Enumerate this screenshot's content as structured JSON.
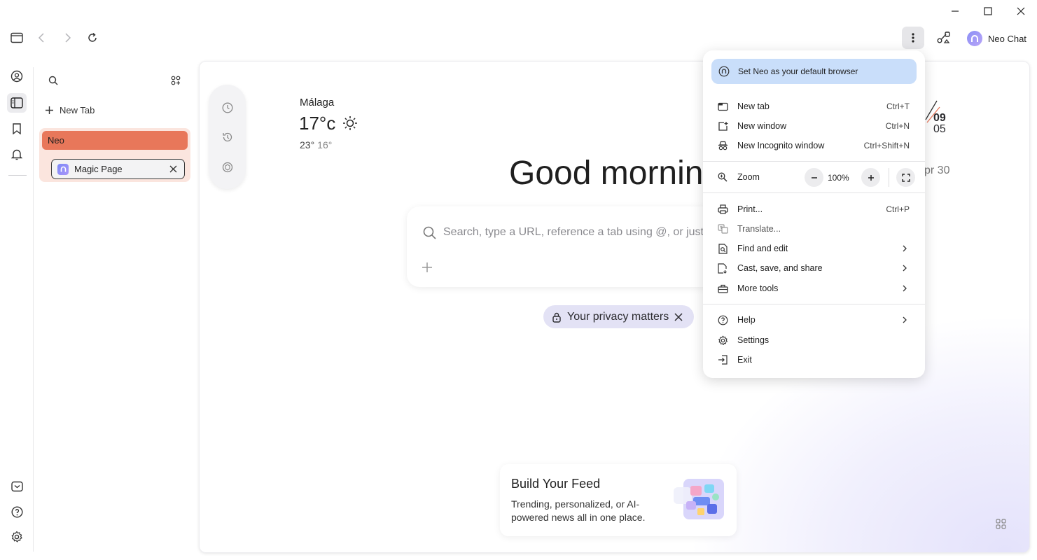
{
  "toolbar": {
    "profile_label": "Neo Chat"
  },
  "sidebar": {
    "new_tab": "New Tab",
    "group_name": "Neo",
    "tab_title": "Magic Page"
  },
  "weather": {
    "city": "Málaga",
    "temp": "17°c",
    "high": "23°",
    "low": "16°"
  },
  "clock": {
    "hour": "09",
    "minute": "05",
    "date_partial": "pr 30"
  },
  "greeting": "Good morning",
  "search": {
    "placeholder": "Search, type a URL, reference a tab using @, or just a"
  },
  "privacy_pill": "Your privacy matters",
  "feed": {
    "title": "Build Your Feed",
    "description": "Trending, personalized, or AI-powered news all in one place."
  },
  "menu": {
    "default_banner": "Set Neo as your default browser",
    "new_tab": {
      "label": "New tab",
      "shortcut": "Ctrl+T"
    },
    "new_window": {
      "label": "New window",
      "shortcut": "Ctrl+N"
    },
    "new_incognito": {
      "label": "New Incognito window",
      "shortcut": "Ctrl+Shift+N"
    },
    "zoom": {
      "label": "Zoom",
      "value": "100%"
    },
    "print": {
      "label": "Print...",
      "shortcut": "Ctrl+P"
    },
    "translate": {
      "label": "Translate..."
    },
    "find_edit": {
      "label": "Find and edit"
    },
    "cast_save": {
      "label": "Cast, save, and share"
    },
    "more_tools": {
      "label": "More tools"
    },
    "help": {
      "label": "Help"
    },
    "settings": {
      "label": "Settings"
    },
    "exit": {
      "label": "Exit"
    }
  },
  "colors": {
    "accent_orange": "#e8775a",
    "banner_blue": "#c9defa",
    "neo_purple": "#8b8ff5"
  }
}
